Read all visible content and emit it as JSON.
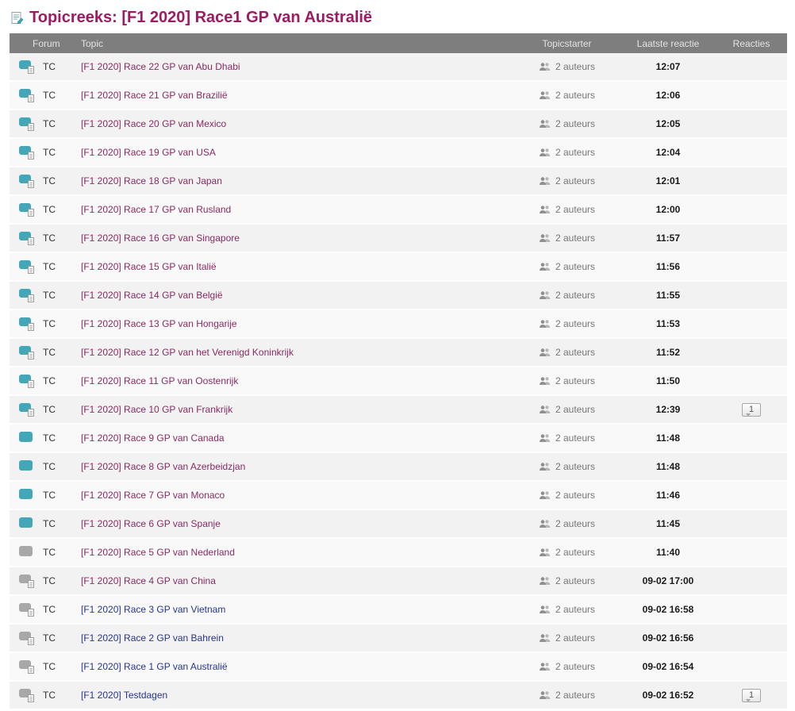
{
  "page": {
    "title": "Topicreeks: [F1 2020] Race1 GP van Australië"
  },
  "table": {
    "headers": {
      "forum": "Forum",
      "topic": "Topic",
      "topicstarter": "Topicstarter",
      "last_reply": "Laatste reactie",
      "replies": "Reacties"
    },
    "rows": [
      {
        "forum": "TC",
        "topic": "[F1 2020] Race 22 GP van Abu Dhabi",
        "authors": "2 auteurs",
        "last_reply": "12:07",
        "replies": "",
        "icon": "bubble-teal-doc",
        "link_state": "visited"
      },
      {
        "forum": "TC",
        "topic": "[F1 2020] Race 21 GP van Brazilië",
        "authors": "2 auteurs",
        "last_reply": "12:06",
        "replies": "",
        "icon": "bubble-teal-doc",
        "link_state": "visited"
      },
      {
        "forum": "TC",
        "topic": "[F1 2020] Race 20 GP van Mexico",
        "authors": "2 auteurs",
        "last_reply": "12:05",
        "replies": "",
        "icon": "bubble-teal-doc",
        "link_state": "visited"
      },
      {
        "forum": "TC",
        "topic": "[F1 2020] Race 19 GP van USA",
        "authors": "2 auteurs",
        "last_reply": "12:04",
        "replies": "",
        "icon": "bubble-teal-doc",
        "link_state": "visited"
      },
      {
        "forum": "TC",
        "topic": "[F1 2020] Race 18 GP van Japan",
        "authors": "2 auteurs",
        "last_reply": "12:01",
        "replies": "",
        "icon": "bubble-teal-doc",
        "link_state": "visited"
      },
      {
        "forum": "TC",
        "topic": "[F1 2020] Race 17 GP van Rusland",
        "authors": "2 auteurs",
        "last_reply": "12:00",
        "replies": "",
        "icon": "bubble-teal-doc",
        "link_state": "visited"
      },
      {
        "forum": "TC",
        "topic": "[F1 2020] Race 16 GP van Singapore",
        "authors": "2 auteurs",
        "last_reply": "11:57",
        "replies": "",
        "icon": "bubble-teal-doc",
        "link_state": "visited"
      },
      {
        "forum": "TC",
        "topic": "[F1 2020] Race 15 GP van Italië",
        "authors": "2 auteurs",
        "last_reply": "11:56",
        "replies": "",
        "icon": "bubble-teal-doc",
        "link_state": "visited"
      },
      {
        "forum": "TC",
        "topic": "[F1 2020] Race 14 GP van België",
        "authors": "2 auteurs",
        "last_reply": "11:55",
        "replies": "",
        "icon": "bubble-teal-doc",
        "link_state": "visited"
      },
      {
        "forum": "TC",
        "topic": "[F1 2020] Race 13 GP van Hongarije",
        "authors": "2 auteurs",
        "last_reply": "11:53",
        "replies": "",
        "icon": "bubble-teal-doc",
        "link_state": "visited"
      },
      {
        "forum": "TC",
        "topic": "[F1 2020] Race 12 GP van het Verenigd Koninkrijk",
        "authors": "2 auteurs",
        "last_reply": "11:52",
        "replies": "",
        "icon": "bubble-teal-doc",
        "link_state": "visited"
      },
      {
        "forum": "TC",
        "topic": "[F1 2020] Race 11 GP van Oostenrijk",
        "authors": "2 auteurs",
        "last_reply": "11:50",
        "replies": "",
        "icon": "bubble-teal-doc",
        "link_state": "visited"
      },
      {
        "forum": "TC",
        "topic": "[F1 2020] Race 10 GP van Frankrijk",
        "authors": "2 auteurs",
        "last_reply": "12:39",
        "replies": "1",
        "icon": "bubble-teal-doc",
        "link_state": "visited"
      },
      {
        "forum": "TC",
        "topic": "[F1 2020] Race 9 GP van Canada",
        "authors": "2 auteurs",
        "last_reply": "11:48",
        "replies": "",
        "icon": "bubble-teal",
        "link_state": "visited"
      },
      {
        "forum": "TC",
        "topic": "[F1 2020] Race 8 GP van Azerbeidzjan",
        "authors": "2 auteurs",
        "last_reply": "11:48",
        "replies": "",
        "icon": "bubble-teal",
        "link_state": "visited"
      },
      {
        "forum": "TC",
        "topic": "[F1 2020] Race 7 GP van Monaco",
        "authors": "2 auteurs",
        "last_reply": "11:46",
        "replies": "",
        "icon": "bubble-teal",
        "link_state": "visited"
      },
      {
        "forum": "TC",
        "topic": "[F1 2020] Race 6 GP van Spanje",
        "authors": "2 auteurs",
        "last_reply": "11:45",
        "replies": "",
        "icon": "bubble-teal",
        "link_state": "visited"
      },
      {
        "forum": "TC",
        "topic": "[F1 2020] Race 5 GP van Nederland",
        "authors": "2 auteurs",
        "last_reply": "11:40",
        "replies": "",
        "icon": "bubble-gray",
        "link_state": "visited"
      },
      {
        "forum": "TC",
        "topic": "[F1 2020] Race 4 GP van China",
        "authors": "2 auteurs",
        "last_reply": "09-02 17:00",
        "replies": "",
        "icon": "bubble-gray-doc",
        "link_state": "visited"
      },
      {
        "forum": "TC",
        "topic": "[F1 2020] Race 3 GP van Vietnam",
        "authors": "2 auteurs",
        "last_reply": "09-02 16:58",
        "replies": "",
        "icon": "bubble-gray-doc",
        "link_state": "new"
      },
      {
        "forum": "TC",
        "topic": "[F1 2020] Race 2 GP van Bahrein",
        "authors": "2 auteurs",
        "last_reply": "09-02 16:56",
        "replies": "",
        "icon": "bubble-gray-doc",
        "link_state": "new"
      },
      {
        "forum": "TC",
        "topic": "[F1 2020] Race 1 GP van Australië",
        "authors": "2 auteurs",
        "last_reply": "09-02 16:54",
        "replies": "",
        "icon": "bubble-gray-doc",
        "link_state": "new"
      },
      {
        "forum": "TC",
        "topic": "[F1 2020] Testdagen",
        "authors": "2 auteurs",
        "last_reply": "09-02 16:52",
        "replies": "1",
        "icon": "bubble-gray-doc",
        "link_state": "new"
      }
    ]
  },
  "colors": {
    "title": "#9e1a62",
    "header_bg": "#7e7e7e",
    "header_text": "#e3e3e3",
    "icon_teal": "#43a7b8",
    "icon_gray": "#a8a8a8",
    "link_visited": "#8a2a62",
    "link_new": "#26358f",
    "row_odd": "#f2f2f2",
    "row_even": "#f9f9f9"
  }
}
